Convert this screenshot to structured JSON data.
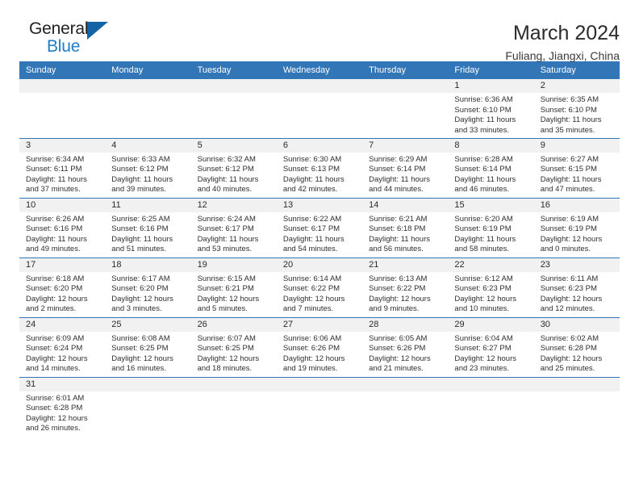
{
  "brand": {
    "name_top": "General",
    "name_bottom": "Blue",
    "triangle_color": "#1464a5",
    "blue_text_color": "#1f7fc4"
  },
  "header": {
    "title": "March 2024",
    "subtitle": "Fuliang, Jiangxi, China"
  },
  "theme": {
    "header_row_bg": "#3276b8",
    "daynum_band_bg": "#f1f1f1",
    "separator_color": "#3276b8",
    "text_color": "#2f2f2f"
  },
  "weekday_headers": [
    "Sunday",
    "Monday",
    "Tuesday",
    "Wednesday",
    "Thursday",
    "Friday",
    "Saturday"
  ],
  "weeks": [
    [
      {
        "day": "",
        "lines": []
      },
      {
        "day": "",
        "lines": []
      },
      {
        "day": "",
        "lines": []
      },
      {
        "day": "",
        "lines": []
      },
      {
        "day": "",
        "lines": []
      },
      {
        "day": "1",
        "lines": [
          "Sunrise: 6:36 AM",
          "Sunset: 6:10 PM",
          "Daylight: 11 hours",
          "and 33 minutes."
        ]
      },
      {
        "day": "2",
        "lines": [
          "Sunrise: 6:35 AM",
          "Sunset: 6:10 PM",
          "Daylight: 11 hours",
          "and 35 minutes."
        ]
      }
    ],
    [
      {
        "day": "3",
        "lines": [
          "Sunrise: 6:34 AM",
          "Sunset: 6:11 PM",
          "Daylight: 11 hours",
          "and 37 minutes."
        ]
      },
      {
        "day": "4",
        "lines": [
          "Sunrise: 6:33 AM",
          "Sunset: 6:12 PM",
          "Daylight: 11 hours",
          "and 39 minutes."
        ]
      },
      {
        "day": "5",
        "lines": [
          "Sunrise: 6:32 AM",
          "Sunset: 6:12 PM",
          "Daylight: 11 hours",
          "and 40 minutes."
        ]
      },
      {
        "day": "6",
        "lines": [
          "Sunrise: 6:30 AM",
          "Sunset: 6:13 PM",
          "Daylight: 11 hours",
          "and 42 minutes."
        ]
      },
      {
        "day": "7",
        "lines": [
          "Sunrise: 6:29 AM",
          "Sunset: 6:14 PM",
          "Daylight: 11 hours",
          "and 44 minutes."
        ]
      },
      {
        "day": "8",
        "lines": [
          "Sunrise: 6:28 AM",
          "Sunset: 6:14 PM",
          "Daylight: 11 hours",
          "and 46 minutes."
        ]
      },
      {
        "day": "9",
        "lines": [
          "Sunrise: 6:27 AM",
          "Sunset: 6:15 PM",
          "Daylight: 11 hours",
          "and 47 minutes."
        ]
      }
    ],
    [
      {
        "day": "10",
        "lines": [
          "Sunrise: 6:26 AM",
          "Sunset: 6:16 PM",
          "Daylight: 11 hours",
          "and 49 minutes."
        ]
      },
      {
        "day": "11",
        "lines": [
          "Sunrise: 6:25 AM",
          "Sunset: 6:16 PM",
          "Daylight: 11 hours",
          "and 51 minutes."
        ]
      },
      {
        "day": "12",
        "lines": [
          "Sunrise: 6:24 AM",
          "Sunset: 6:17 PM",
          "Daylight: 11 hours",
          "and 53 minutes."
        ]
      },
      {
        "day": "13",
        "lines": [
          "Sunrise: 6:22 AM",
          "Sunset: 6:17 PM",
          "Daylight: 11 hours",
          "and 54 minutes."
        ]
      },
      {
        "day": "14",
        "lines": [
          "Sunrise: 6:21 AM",
          "Sunset: 6:18 PM",
          "Daylight: 11 hours",
          "and 56 minutes."
        ]
      },
      {
        "day": "15",
        "lines": [
          "Sunrise: 6:20 AM",
          "Sunset: 6:19 PM",
          "Daylight: 11 hours",
          "and 58 minutes."
        ]
      },
      {
        "day": "16",
        "lines": [
          "Sunrise: 6:19 AM",
          "Sunset: 6:19 PM",
          "Daylight: 12 hours",
          "and 0 minutes."
        ]
      }
    ],
    [
      {
        "day": "17",
        "lines": [
          "Sunrise: 6:18 AM",
          "Sunset: 6:20 PM",
          "Daylight: 12 hours",
          "and 2 minutes."
        ]
      },
      {
        "day": "18",
        "lines": [
          "Sunrise: 6:17 AM",
          "Sunset: 6:20 PM",
          "Daylight: 12 hours",
          "and 3 minutes."
        ]
      },
      {
        "day": "19",
        "lines": [
          "Sunrise: 6:15 AM",
          "Sunset: 6:21 PM",
          "Daylight: 12 hours",
          "and 5 minutes."
        ]
      },
      {
        "day": "20",
        "lines": [
          "Sunrise: 6:14 AM",
          "Sunset: 6:22 PM",
          "Daylight: 12 hours",
          "and 7 minutes."
        ]
      },
      {
        "day": "21",
        "lines": [
          "Sunrise: 6:13 AM",
          "Sunset: 6:22 PM",
          "Daylight: 12 hours",
          "and 9 minutes."
        ]
      },
      {
        "day": "22",
        "lines": [
          "Sunrise: 6:12 AM",
          "Sunset: 6:23 PM",
          "Daylight: 12 hours",
          "and 10 minutes."
        ]
      },
      {
        "day": "23",
        "lines": [
          "Sunrise: 6:11 AM",
          "Sunset: 6:23 PM",
          "Daylight: 12 hours",
          "and 12 minutes."
        ]
      }
    ],
    [
      {
        "day": "24",
        "lines": [
          "Sunrise: 6:09 AM",
          "Sunset: 6:24 PM",
          "Daylight: 12 hours",
          "and 14 minutes."
        ]
      },
      {
        "day": "25",
        "lines": [
          "Sunrise: 6:08 AM",
          "Sunset: 6:25 PM",
          "Daylight: 12 hours",
          "and 16 minutes."
        ]
      },
      {
        "day": "26",
        "lines": [
          "Sunrise: 6:07 AM",
          "Sunset: 6:25 PM",
          "Daylight: 12 hours",
          "and 18 minutes."
        ]
      },
      {
        "day": "27",
        "lines": [
          "Sunrise: 6:06 AM",
          "Sunset: 6:26 PM",
          "Daylight: 12 hours",
          "and 19 minutes."
        ]
      },
      {
        "day": "28",
        "lines": [
          "Sunrise: 6:05 AM",
          "Sunset: 6:26 PM",
          "Daylight: 12 hours",
          "and 21 minutes."
        ]
      },
      {
        "day": "29",
        "lines": [
          "Sunrise: 6:04 AM",
          "Sunset: 6:27 PM",
          "Daylight: 12 hours",
          "and 23 minutes."
        ]
      },
      {
        "day": "30",
        "lines": [
          "Sunrise: 6:02 AM",
          "Sunset: 6:28 PM",
          "Daylight: 12 hours",
          "and 25 minutes."
        ]
      }
    ],
    [
      {
        "day": "31",
        "lines": [
          "Sunrise: 6:01 AM",
          "Sunset: 6:28 PM",
          "Daylight: 12 hours",
          "and 26 minutes."
        ]
      },
      {
        "day": "",
        "lines": []
      },
      {
        "day": "",
        "lines": []
      },
      {
        "day": "",
        "lines": []
      },
      {
        "day": "",
        "lines": []
      },
      {
        "day": "",
        "lines": []
      },
      {
        "day": "",
        "lines": []
      }
    ]
  ]
}
